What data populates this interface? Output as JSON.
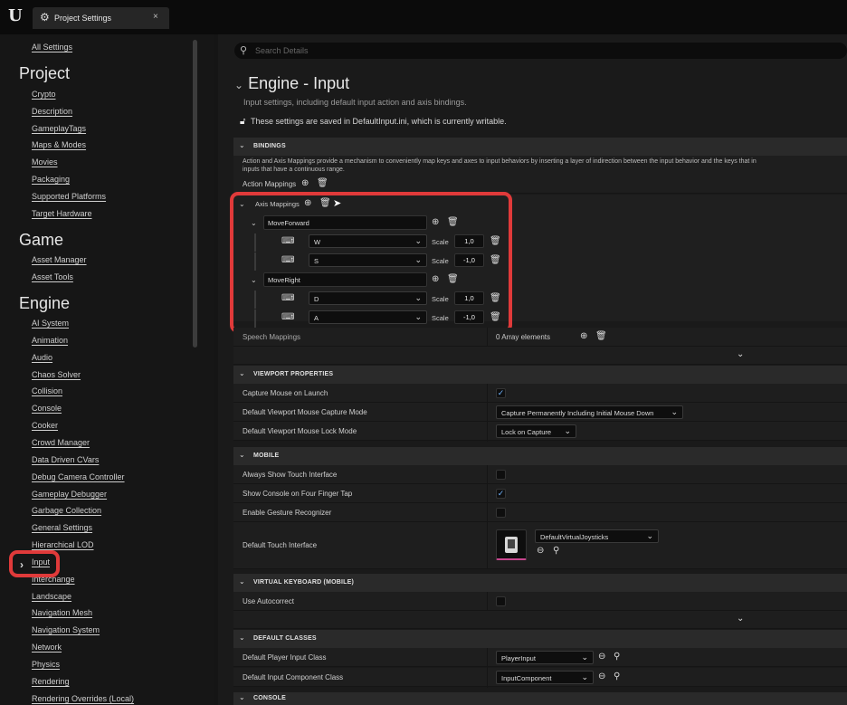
{
  "window": {
    "tab_title": "Project Settings",
    "close": "×"
  },
  "nav": {
    "all_settings": "All Settings",
    "project_header": "Project",
    "project_items": [
      "Crypto",
      "Description",
      "GameplayTags",
      "Maps & Modes",
      "Movies",
      "Packaging",
      "Supported Platforms",
      "Target Hardware"
    ],
    "game_header": "Game",
    "game_items": [
      "Asset Manager",
      "Asset Tools"
    ],
    "engine_header": "Engine",
    "engine_items": [
      "AI System",
      "Animation",
      "Audio",
      "Chaos Solver",
      "Collision",
      "Console",
      "Cooker",
      "Crowd Manager",
      "Data Driven CVars",
      "Debug Camera Controller",
      "Gameplay Debugger",
      "Garbage Collection",
      "General Settings",
      "Hierarchical LOD",
      "Input",
      "Interchange",
      "Landscape",
      "Navigation Mesh",
      "Navigation System",
      "Network",
      "Physics",
      "Rendering",
      "Rendering Overrides (Local)"
    ],
    "selected": "Input"
  },
  "search": {
    "placeholder": "Search Details"
  },
  "header": {
    "title": "Engine - Input",
    "subtitle": "Input settings, including default input action and axis bindings.",
    "notice": "These settings are saved in DefaultInput.ini, which is currently writable."
  },
  "bindings": {
    "section": "BINDINGS",
    "description_1": "Action and Axis Mappings provide a mechanism to conveniently map keys and axes to input behaviors by inserting a layer of indirection between the input behavior and the keys that in",
    "description_2": "inputs that have a continuous range.",
    "action_mappings": "Action Mappings",
    "axis_mappings": "Axis Mappings",
    "scale_label": "Scale",
    "axes": [
      {
        "name": "MoveForward",
        "keys": [
          {
            "key": "W",
            "scale": "1,0"
          },
          {
            "key": "S",
            "scale": "-1,0"
          }
        ]
      },
      {
        "name": "MoveRight",
        "keys": [
          {
            "key": "D",
            "scale": "1,0"
          },
          {
            "key": "A",
            "scale": "-1,0"
          }
        ]
      }
    ],
    "speech_mappings": "Speech Mappings",
    "speech_value": "0 Array elements"
  },
  "viewport": {
    "section": "VIEWPORT PROPERTIES",
    "capture_on_launch": "Capture Mouse on Launch",
    "capture_mode_label": "Default Viewport Mouse Capture Mode",
    "capture_mode_value": "Capture Permanently Including Initial Mouse Down",
    "lock_mode_label": "Default Viewport Mouse Lock Mode",
    "lock_mode_value": "Lock on Capture"
  },
  "mobile": {
    "section": "MOBILE",
    "always_touch": "Always Show Touch Interface",
    "console_four": "Show Console on Four Finger Tap",
    "gesture": "Enable Gesture Recognizer",
    "touch_interface_label": "Default Touch Interface",
    "touch_interface_value": "DefaultVirtualJoysticks"
  },
  "virtual_keyboard": {
    "section": "VIRTUAL KEYBOARD (MOBILE)",
    "autocorrect": "Use Autocorrect"
  },
  "default_classes": {
    "section": "DEFAULT CLASSES",
    "player_input_label": "Default Player Input Class",
    "player_input_value": "PlayerInput",
    "input_component_label": "Default Input Component Class",
    "input_component_value": "InputComponent"
  },
  "console": {
    "section": "CONSOLE"
  },
  "checkboxes": {
    "capture_on_launch": true,
    "always_touch": false,
    "console_four": true,
    "gesture": false,
    "autocorrect": false
  },
  "colors": {
    "highlight": "#e03a3a",
    "check": "#6fb3ff",
    "asset_underline": "#c8468e"
  }
}
